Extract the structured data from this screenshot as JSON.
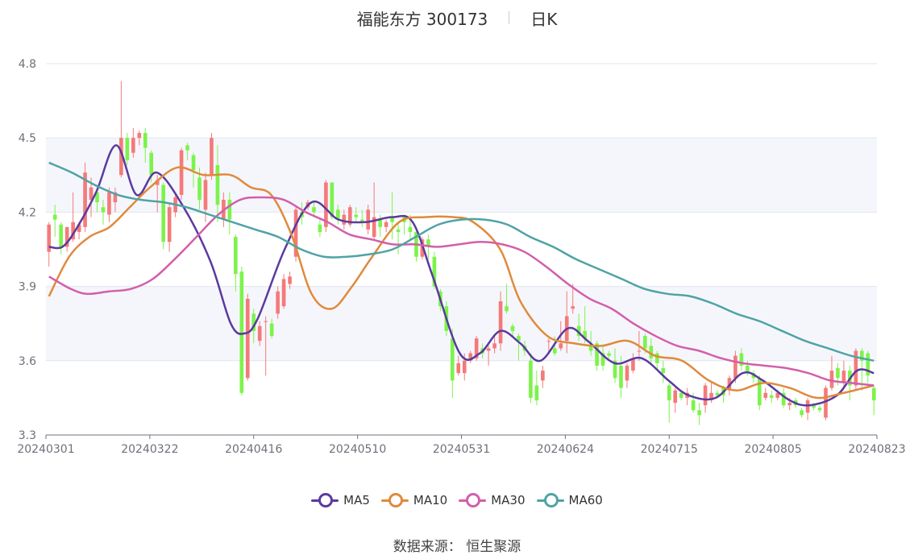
{
  "title": {
    "name": "福能东方 300173",
    "period": "日K"
  },
  "source": "数据来源： 恒生聚源",
  "chart_data": {
    "type": "candlestick",
    "ylim": [
      3.3,
      4.8
    ],
    "yticks": [
      "3.3",
      "3.6",
      "3.9",
      "4.2",
      "4.5",
      "4.8"
    ],
    "xticks": [
      "20240301",
      "20240322",
      "20240416",
      "20240510",
      "20240531",
      "20240624",
      "20240715",
      "20240805",
      "20240823"
    ],
    "colors": {
      "up": "#F47A7A",
      "down": "#7CF34B",
      "MA5": "#5B3A9E",
      "MA10": "#E08A3C",
      "MA30": "#D25FAA",
      "MA60": "#4FA3A5"
    },
    "candles": [
      [
        4.04,
        4.15,
        3.98,
        4.16
      ],
      [
        4.19,
        4.17,
        4.1,
        4.23
      ],
      [
        4.15,
        4.06,
        4.03,
        4.16
      ],
      [
        4.06,
        4.14,
        4.04,
        4.14
      ],
      [
        4.09,
        4.16,
        4.08,
        4.28
      ],
      [
        4.12,
        4.15,
        4.09,
        4.16
      ],
      [
        4.14,
        4.36,
        4.12,
        4.4
      ],
      [
        4.25,
        4.3,
        4.18,
        4.34
      ],
      [
        4.28,
        4.24,
        4.2,
        4.3
      ],
      [
        4.22,
        4.2,
        4.15,
        4.25
      ],
      [
        4.19,
        4.28,
        4.16,
        4.3
      ],
      [
        4.24,
        4.28,
        4.2,
        4.3
      ],
      [
        4.35,
        4.5,
        4.34,
        4.73
      ],
      [
        4.5,
        4.41,
        4.39,
        4.52
      ],
      [
        4.44,
        4.5,
        4.42,
        4.54
      ],
      [
        4.5,
        4.52,
        4.47,
        4.53
      ],
      [
        4.52,
        4.46,
        4.4,
        4.54
      ],
      [
        4.44,
        4.35,
        4.32,
        4.45
      ],
      [
        4.31,
        4.33,
        4.2,
        4.35
      ],
      [
        4.31,
        4.08,
        4.05,
        4.32
      ],
      [
        4.08,
        4.22,
        4.04,
        4.24
      ],
      [
        4.2,
        4.26,
        4.18,
        4.28
      ],
      [
        4.27,
        4.45,
        4.25,
        4.46
      ],
      [
        4.47,
        4.45,
        4.41,
        4.48
      ],
      [
        4.43,
        4.37,
        4.3,
        4.44
      ],
      [
        4.34,
        4.25,
        4.21,
        4.38
      ],
      [
        4.21,
        4.33,
        4.16,
        4.36
      ],
      [
        4.35,
        4.5,
        4.33,
        4.52
      ],
      [
        4.39,
        4.23,
        4.16,
        4.47
      ],
      [
        4.17,
        4.25,
        4.14,
        4.28
      ],
      [
        4.25,
        4.17,
        4.11,
        4.28
      ],
      [
        4.1,
        3.95,
        3.88,
        4.11
      ],
      [
        3.96,
        3.47,
        3.46,
        3.98
      ],
      [
        3.53,
        3.85,
        3.52,
        3.87
      ],
      [
        3.79,
        3.72,
        3.67,
        3.81
      ],
      [
        3.68,
        3.74,
        3.66,
        3.76
      ],
      [
        3.76,
        3.76,
        3.54,
        3.78
      ],
      [
        3.75,
        3.7,
        3.69,
        3.77
      ],
      [
        3.79,
        3.88,
        3.77,
        3.9
      ],
      [
        3.82,
        3.93,
        3.81,
        3.95
      ],
      [
        3.91,
        3.94,
        3.89,
        3.96
      ],
      [
        4.02,
        4.21,
        4.0,
        4.22
      ],
      [
        4.2,
        4.18,
        4.15,
        4.24
      ],
      [
        4.22,
        4.24,
        4.21,
        4.25
      ],
      [
        4.22,
        4.2,
        4.18,
        4.24
      ],
      [
        4.15,
        4.12,
        4.1,
        4.17
      ],
      [
        4.14,
        4.32,
        4.12,
        4.33
      ],
      [
        4.32,
        4.18,
        4.17,
        4.32
      ],
      [
        4.21,
        4.17,
        4.15,
        4.23
      ],
      [
        4.15,
        4.19,
        4.13,
        4.21
      ],
      [
        4.15,
        4.22,
        4.14,
        4.23
      ],
      [
        4.19,
        4.18,
        4.16,
        4.22
      ],
      [
        4.17,
        4.16,
        4.14,
        4.21
      ],
      [
        4.13,
        4.21,
        4.11,
        4.23
      ],
      [
        4.1,
        4.18,
        4.09,
        4.32
      ],
      [
        4.17,
        4.14,
        4.1,
        4.19
      ],
      [
        4.14,
        4.16,
        4.12,
        4.17
      ],
      [
        4.18,
        4.16,
        4.09,
        4.28
      ],
      [
        4.13,
        4.12,
        4.03,
        4.16
      ],
      [
        4.18,
        4.16,
        4.11,
        4.19
      ],
      [
        4.14,
        4.12,
        4.09,
        4.19
      ],
      [
        4.12,
        4.02,
        4.0,
        4.14
      ],
      [
        4.02,
        4.09,
        4.01,
        4.1
      ],
      [
        4.09,
        4.06,
        4.01,
        4.11
      ],
      [
        4.02,
        3.9,
        3.89,
        4.04
      ],
      [
        3.88,
        3.82,
        3.8,
        3.89
      ],
      [
        3.82,
        3.72,
        3.7,
        3.84
      ],
      [
        3.69,
        3.52,
        3.45,
        3.73
      ],
      [
        3.55,
        3.59,
        3.54,
        3.62
      ],
      [
        3.55,
        3.6,
        3.52,
        3.63
      ],
      [
        3.6,
        3.63,
        3.59,
        3.64
      ],
      [
        3.61,
        3.69,
        3.6,
        3.7
      ],
      [
        3.65,
        3.63,
        3.61,
        3.67
      ],
      [
        3.64,
        3.65,
        3.58,
        3.66
      ],
      [
        3.65,
        3.67,
        3.63,
        3.7
      ],
      [
        3.67,
        3.84,
        3.64,
        3.88
      ],
      [
        3.82,
        3.8,
        3.79,
        3.91
      ],
      [
        3.74,
        3.72,
        3.7,
        3.75
      ],
      [
        3.7,
        3.68,
        3.6,
        3.71
      ],
      [
        3.66,
        3.64,
        3.62,
        3.68
      ],
      [
        3.6,
        3.45,
        3.43,
        3.63
      ],
      [
        3.5,
        3.44,
        3.42,
        3.56
      ],
      [
        3.52,
        3.56,
        3.49,
        3.58
      ],
      [
        3.68,
        3.68,
        3.63,
        3.69
      ],
      [
        3.65,
        3.63,
        3.62,
        3.7
      ],
      [
        3.65,
        3.67,
        3.64,
        3.76
      ],
      [
        3.68,
        3.78,
        3.63,
        3.88
      ],
      [
        3.81,
        3.82,
        3.79,
        3.91
      ],
      [
        3.74,
        3.7,
        3.68,
        3.79
      ],
      [
        3.72,
        3.69,
        3.67,
        3.82
      ],
      [
        3.66,
        3.64,
        3.62,
        3.72
      ],
      [
        3.67,
        3.58,
        3.56,
        3.68
      ],
      [
        3.63,
        3.58,
        3.56,
        3.66
      ],
      [
        3.63,
        3.62,
        3.61,
        3.64
      ],
      [
        3.6,
        3.53,
        3.51,
        3.65
      ],
      [
        3.58,
        3.49,
        3.45,
        3.62
      ],
      [
        3.52,
        3.58,
        3.49,
        3.59
      ],
      [
        3.56,
        3.61,
        3.55,
        3.63
      ],
      [
        3.64,
        3.64,
        3.6,
        3.72
      ],
      [
        3.7,
        3.65,
        3.63,
        3.71
      ],
      [
        3.66,
        3.61,
        3.59,
        3.69
      ],
      [
        3.63,
        3.59,
        3.56,
        3.64
      ],
      [
        3.57,
        3.55,
        3.51,
        3.6
      ],
      [
        3.5,
        3.44,
        3.35,
        3.51
      ],
      [
        3.43,
        3.48,
        3.39,
        3.49
      ],
      [
        3.47,
        3.45,
        3.44,
        3.48
      ],
      [
        3.45,
        3.47,
        3.42,
        3.49
      ],
      [
        3.44,
        3.4,
        3.39,
        3.47
      ],
      [
        3.4,
        3.38,
        3.34,
        3.43
      ],
      [
        3.42,
        3.5,
        3.39,
        3.51
      ],
      [
        3.44,
        3.47,
        3.43,
        3.51
      ],
      [
        3.47,
        3.46,
        3.45,
        3.48
      ],
      [
        3.49,
        3.46,
        3.43,
        3.5
      ],
      [
        3.48,
        3.53,
        3.46,
        3.54
      ],
      [
        3.53,
        3.62,
        3.51,
        3.64
      ],
      [
        3.63,
        3.58,
        3.56,
        3.65
      ],
      [
        3.58,
        3.55,
        3.54,
        3.6
      ],
      [
        3.55,
        3.53,
        3.51,
        3.56
      ],
      [
        3.53,
        3.42,
        3.4,
        3.54
      ],
      [
        3.45,
        3.47,
        3.44,
        3.49
      ],
      [
        3.46,
        3.45,
        3.43,
        3.48
      ],
      [
        3.45,
        3.47,
        3.44,
        3.48
      ],
      [
        3.47,
        3.42,
        3.41,
        3.49
      ],
      [
        3.42,
        3.43,
        3.4,
        3.45
      ],
      [
        3.44,
        3.42,
        3.41,
        3.45
      ],
      [
        3.4,
        3.38,
        3.37,
        3.41
      ],
      [
        3.39,
        3.44,
        3.36,
        3.45
      ],
      [
        3.42,
        3.41,
        3.4,
        3.43
      ],
      [
        3.41,
        3.4,
        3.39,
        3.42
      ],
      [
        3.37,
        3.49,
        3.36,
        3.5
      ],
      [
        3.49,
        3.56,
        3.48,
        3.62
      ],
      [
        3.57,
        3.53,
        3.5,
        3.59
      ],
      [
        3.51,
        3.56,
        3.49,
        3.6
      ],
      [
        3.56,
        3.5,
        3.44,
        3.58
      ],
      [
        3.5,
        3.64,
        3.48,
        3.65
      ],
      [
        3.64,
        3.6,
        3.48,
        3.65
      ],
      [
        3.63,
        3.54,
        3.51,
        3.64
      ],
      [
        3.49,
        3.44,
        3.38,
        3.5
      ]
    ],
    "series": [
      {
        "name": "MA5",
        "points": [
          [
            0,
            4.06
          ],
          [
            4,
            4.06
          ],
          [
            8,
            4.13
          ],
          [
            14,
            4.28
          ],
          [
            20,
            4.47
          ],
          [
            26,
            4.27
          ],
          [
            32,
            4.36
          ],
          [
            40,
            4.22
          ],
          [
            48,
            4.0
          ],
          [
            54,
            3.75
          ],
          [
            58,
            3.71
          ],
          [
            62,
            3.77
          ],
          [
            70,
            4.05
          ],
          [
            78,
            4.24
          ],
          [
            86,
            4.17
          ],
          [
            94,
            4.16
          ],
          [
            102,
            4.18
          ],
          [
            108,
            4.16
          ],
          [
            114,
            3.94
          ],
          [
            122,
            3.63
          ],
          [
            128,
            3.63
          ],
          [
            134,
            3.72
          ],
          [
            140,
            3.67
          ],
          [
            146,
            3.6
          ],
          [
            154,
            3.73
          ],
          [
            160,
            3.68
          ],
          [
            168,
            3.59
          ],
          [
            176,
            3.61
          ],
          [
            184,
            3.52
          ],
          [
            190,
            3.46
          ],
          [
            198,
            3.45
          ],
          [
            206,
            3.55
          ],
          [
            212,
            3.52
          ],
          [
            220,
            3.44
          ],
          [
            226,
            3.42
          ],
          [
            234,
            3.46
          ],
          [
            240,
            3.56
          ],
          [
            245,
            3.55
          ]
        ]
      },
      {
        "name": "MA10",
        "points": [
          [
            0,
            3.86
          ],
          [
            6,
            4.02
          ],
          [
            12,
            4.1
          ],
          [
            18,
            4.14
          ],
          [
            24,
            4.22
          ],
          [
            30,
            4.3
          ],
          [
            38,
            4.38
          ],
          [
            46,
            4.35
          ],
          [
            54,
            4.35
          ],
          [
            60,
            4.3
          ],
          [
            66,
            4.27
          ],
          [
            72,
            4.11
          ],
          [
            78,
            3.87
          ],
          [
            84,
            3.81
          ],
          [
            90,
            3.9
          ],
          [
            96,
            4.02
          ],
          [
            104,
            4.16
          ],
          [
            112,
            4.18
          ],
          [
            120,
            4.18
          ],
          [
            126,
            4.16
          ],
          [
            134,
            4.05
          ],
          [
            140,
            3.84
          ],
          [
            148,
            3.7
          ],
          [
            156,
            3.67
          ],
          [
            164,
            3.66
          ],
          [
            172,
            3.68
          ],
          [
            180,
            3.62
          ],
          [
            188,
            3.6
          ],
          [
            196,
            3.52
          ],
          [
            204,
            3.48
          ],
          [
            212,
            3.51
          ],
          [
            220,
            3.49
          ],
          [
            228,
            3.45
          ],
          [
            236,
            3.47
          ],
          [
            245,
            3.5
          ]
        ]
      },
      {
        "name": "MA30",
        "points": [
          [
            0,
            3.94
          ],
          [
            8,
            3.89
          ],
          [
            14,
            3.87
          ],
          [
            22,
            3.88
          ],
          [
            30,
            3.89
          ],
          [
            38,
            3.93
          ],
          [
            46,
            4.01
          ],
          [
            54,
            4.1
          ],
          [
            62,
            4.19
          ],
          [
            70,
            4.25
          ],
          [
            78,
            4.26
          ],
          [
            86,
            4.25
          ],
          [
            94,
            4.2
          ],
          [
            102,
            4.16
          ],
          [
            110,
            4.11
          ],
          [
            118,
            4.09
          ],
          [
            126,
            4.07
          ],
          [
            134,
            4.07
          ],
          [
            142,
            4.06
          ],
          [
            150,
            4.07
          ],
          [
            158,
            4.08
          ],
          [
            166,
            4.07
          ],
          [
            174,
            4.04
          ],
          [
            182,
            3.98
          ],
          [
            190,
            3.91
          ],
          [
            198,
            3.85
          ],
          [
            206,
            3.81
          ],
          [
            214,
            3.75
          ],
          [
            222,
            3.7
          ],
          [
            230,
            3.66
          ],
          [
            238,
            3.64
          ],
          [
            246,
            3.61
          ],
          [
            254,
            3.59
          ],
          [
            262,
            3.58
          ],
          [
            270,
            3.57
          ],
          [
            278,
            3.55
          ],
          [
            286,
            3.52
          ],
          [
            294,
            3.51
          ],
          [
            302,
            3.5
          ]
        ]
      },
      {
        "name": "MA60",
        "points": [
          [
            0,
            4.4
          ],
          [
            8,
            4.36
          ],
          [
            16,
            4.31
          ],
          [
            24,
            4.27
          ],
          [
            32,
            4.25
          ],
          [
            40,
            4.24
          ],
          [
            48,
            4.22
          ],
          [
            56,
            4.19
          ],
          [
            64,
            4.16
          ],
          [
            72,
            4.13
          ],
          [
            80,
            4.1
          ],
          [
            88,
            4.05
          ],
          [
            96,
            4.02
          ],
          [
            104,
            4.02
          ],
          [
            112,
            4.03
          ],
          [
            120,
            4.05
          ],
          [
            128,
            4.1
          ],
          [
            136,
            4.15
          ],
          [
            144,
            4.17
          ],
          [
            152,
            4.17
          ],
          [
            160,
            4.15
          ],
          [
            168,
            4.1
          ],
          [
            176,
            4.06
          ],
          [
            184,
            4.01
          ],
          [
            192,
            3.97
          ],
          [
            200,
            3.93
          ],
          [
            208,
            3.89
          ],
          [
            216,
            3.87
          ],
          [
            224,
            3.86
          ],
          [
            232,
            3.83
          ],
          [
            240,
            3.79
          ],
          [
            248,
            3.76
          ],
          [
            256,
            3.72
          ],
          [
            264,
            3.68
          ],
          [
            272,
            3.65
          ],
          [
            280,
            3.62
          ],
          [
            288,
            3.6
          ]
        ]
      }
    ]
  }
}
